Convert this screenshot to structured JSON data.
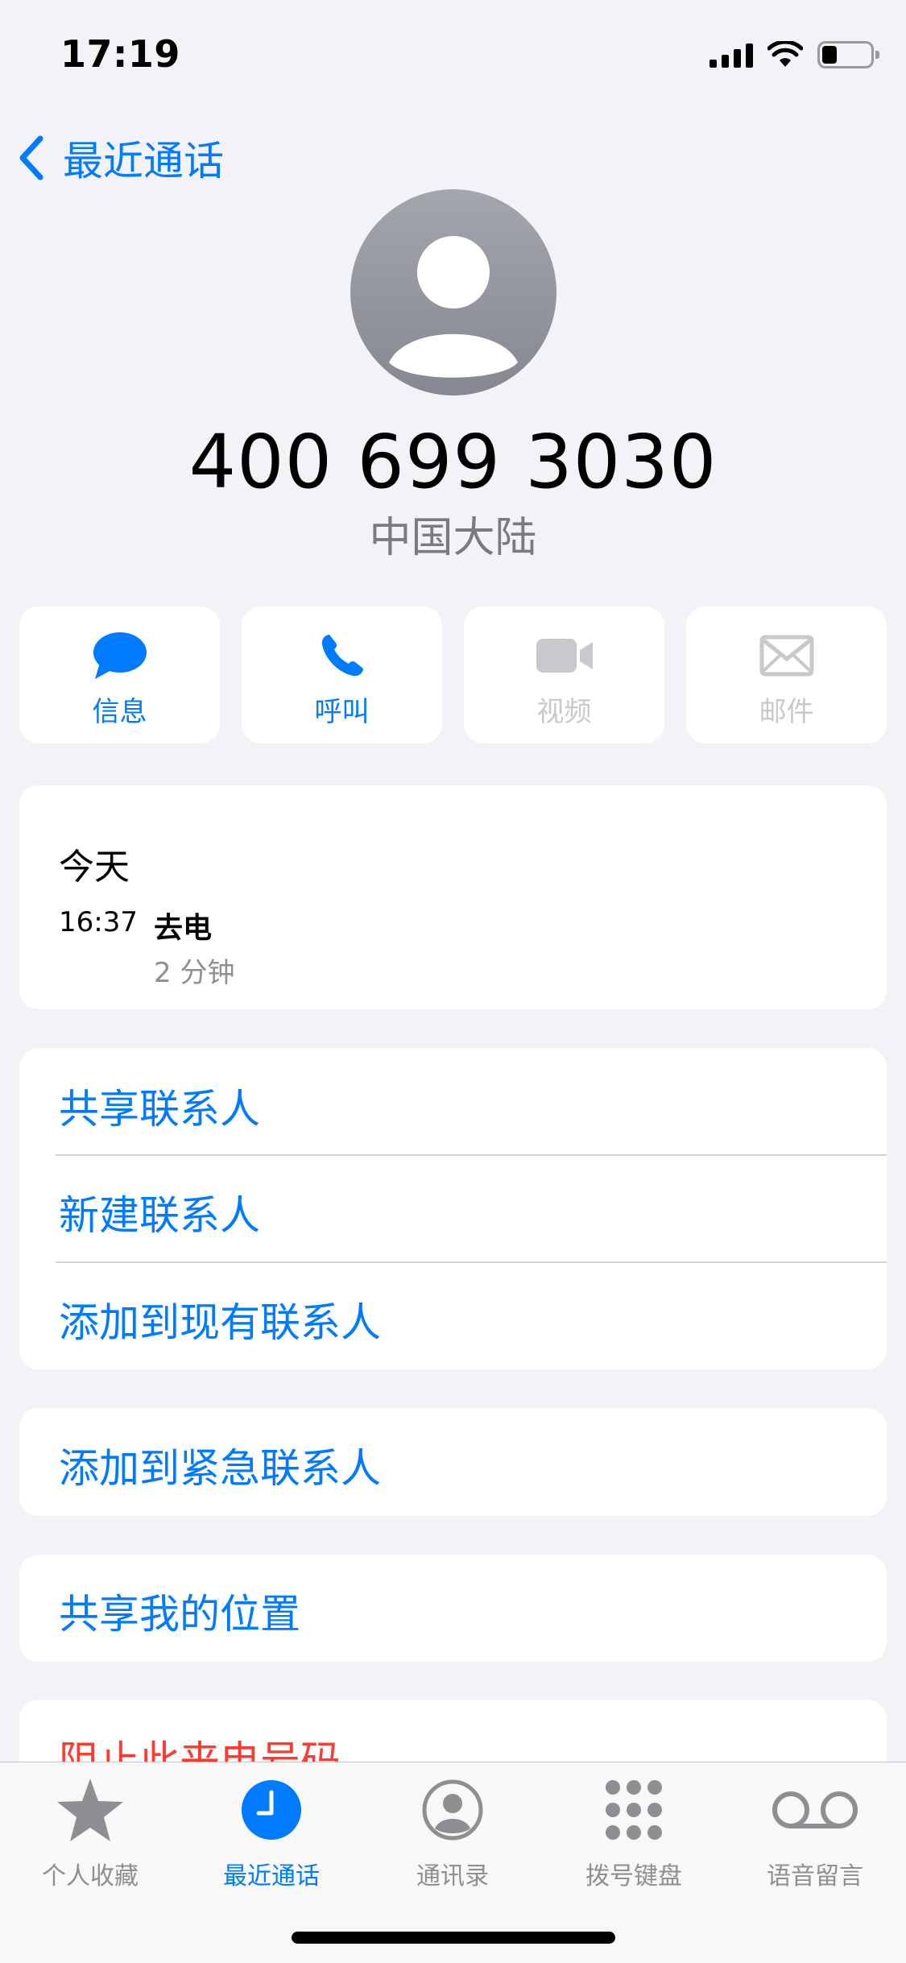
{
  "status_bar": {
    "time": "17:19"
  },
  "nav": {
    "back_label": "最近通话"
  },
  "contact": {
    "number": "400 699 3030",
    "region": "中国大陆"
  },
  "actions": [
    {
      "label": "信息",
      "icon": "message-bubble-icon",
      "enabled": true
    },
    {
      "label": "呼叫",
      "icon": "phone-icon",
      "enabled": true
    },
    {
      "label": "视频",
      "icon": "video-camera-icon",
      "enabled": false
    },
    {
      "label": "邮件",
      "icon": "envelope-icon",
      "enabled": false
    }
  ],
  "call_history": {
    "day": "今天",
    "entries": [
      {
        "time": "16:37",
        "type": "去电",
        "duration": "2 分钟"
      }
    ]
  },
  "contact_actions": [
    "共享联系人",
    "新建联系人",
    "添加到现有联系人"
  ],
  "emergency_action": "添加到紧急联系人",
  "location_action": "共享我的位置",
  "block_action": "阻止此来电号码",
  "tabs": [
    {
      "label": "个人收藏",
      "icon": "star-icon",
      "active": false
    },
    {
      "label": "最近通话",
      "icon": "clock-icon",
      "active": true
    },
    {
      "label": "通讯录",
      "icon": "contacts-icon",
      "active": false
    },
    {
      "label": "拨号键盘",
      "icon": "keypad-icon",
      "active": false
    },
    {
      "label": "语音留言",
      "icon": "voicemail-icon",
      "active": false
    }
  ],
  "colors": {
    "accent": "#007aff",
    "destructive": "#ff3b30",
    "background": "#f2f2f7",
    "disabled": "#c9c9cd"
  }
}
